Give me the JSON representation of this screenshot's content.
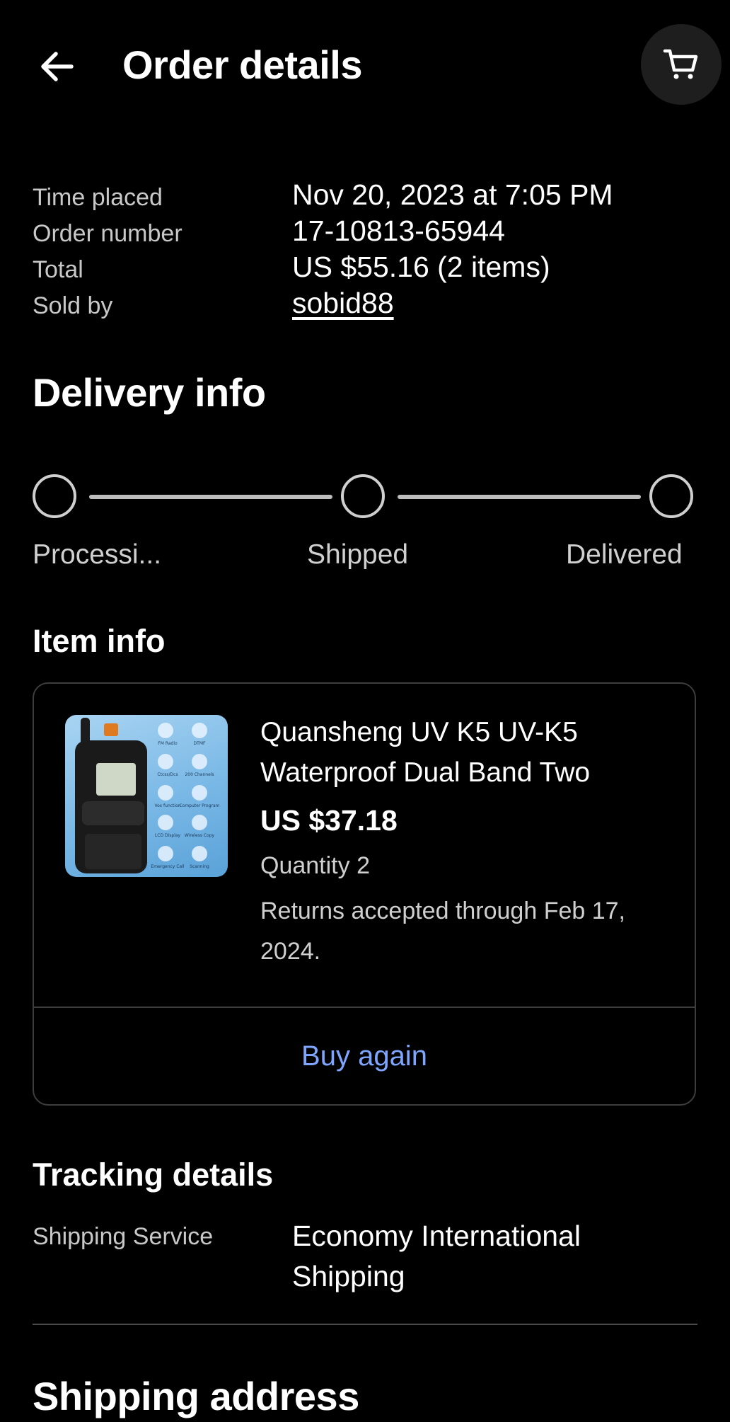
{
  "header": {
    "title": "Order details",
    "back_icon": "arrow-left-icon",
    "cart_icon": "cart-icon"
  },
  "order": {
    "time_placed_label": "Time placed",
    "time_placed_value": "Nov 20, 2023 at 7:05 PM",
    "order_number_label": "Order number",
    "order_number_value": "17-10813-65944",
    "total_label": "Total",
    "total_value": "US $55.16 (2 items)",
    "sold_by_label": "Sold by",
    "sold_by_value": "sobid88"
  },
  "delivery": {
    "heading": "Delivery info",
    "steps": [
      {
        "label": "Processi..."
      },
      {
        "label": "Shipped"
      },
      {
        "label": "Delivered"
      }
    ]
  },
  "item_info": {
    "heading": "Item info",
    "title": "Quansheng UV K5 UV-K5 Waterproof Dual Band Two",
    "price": "US $37.18",
    "quantity": "Quantity 2",
    "returns": " Returns accepted through Feb 17, 2024.",
    "buy_again": "Buy again",
    "image_labels": [
      "FM Radio",
      "DTMF",
      "Ctcss/Dcs",
      "200 Channels",
      "Vox function",
      "Computer Program",
      "LCD Display",
      "Wireless Copy",
      "Emergency Call",
      "Scanning"
    ]
  },
  "tracking": {
    "heading": "Tracking details",
    "shipping_service_label": "Shipping Service",
    "shipping_service_value": "Economy International Shipping"
  },
  "shipping_address": {
    "heading": "Shipping address"
  },
  "colors": {
    "background": "#000000",
    "link_blue": "#7ea6ff",
    "card_border": "#3d3d3d"
  }
}
